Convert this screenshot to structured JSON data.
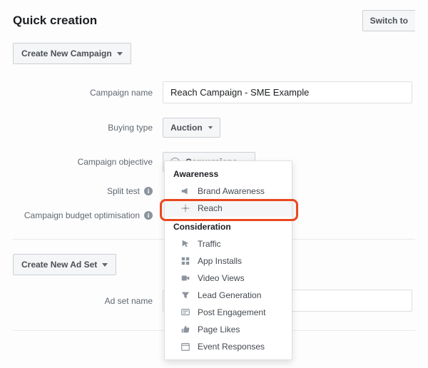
{
  "header": {
    "title": "Quick creation",
    "switch_label": "Switch to"
  },
  "campaign": {
    "create_btn": "Create New Campaign",
    "name_label": "Campaign name",
    "name_value": "Reach Campaign - SME Example",
    "buying_type_label": "Buying type",
    "buying_type_value": "Auction",
    "objective_label": "Campaign objective",
    "objective_value": "Conversions",
    "split_test_label": "Split test",
    "budget_opt_label": "Campaign budget optimisation"
  },
  "adset": {
    "create_btn": "Create New Ad Set",
    "name_label": "Ad set name"
  },
  "dropdown": {
    "groups": [
      {
        "heading": "Awareness",
        "items": [
          {
            "icon": "megaphone-icon",
            "label": "Brand Awareness"
          },
          {
            "icon": "reach-icon",
            "label": "Reach",
            "hovered": true
          }
        ]
      },
      {
        "heading": "Consideration",
        "items": [
          {
            "icon": "cursor-icon",
            "label": "Traffic"
          },
          {
            "icon": "apps-icon",
            "label": "App Installs"
          },
          {
            "icon": "video-icon",
            "label": "Video Views"
          },
          {
            "icon": "funnel-icon",
            "label": "Lead Generation"
          },
          {
            "icon": "post-icon",
            "label": "Post Engagement"
          },
          {
            "icon": "like-icon",
            "label": "Page Likes"
          },
          {
            "icon": "calendar-icon",
            "label": "Event Responses"
          }
        ]
      }
    ]
  }
}
